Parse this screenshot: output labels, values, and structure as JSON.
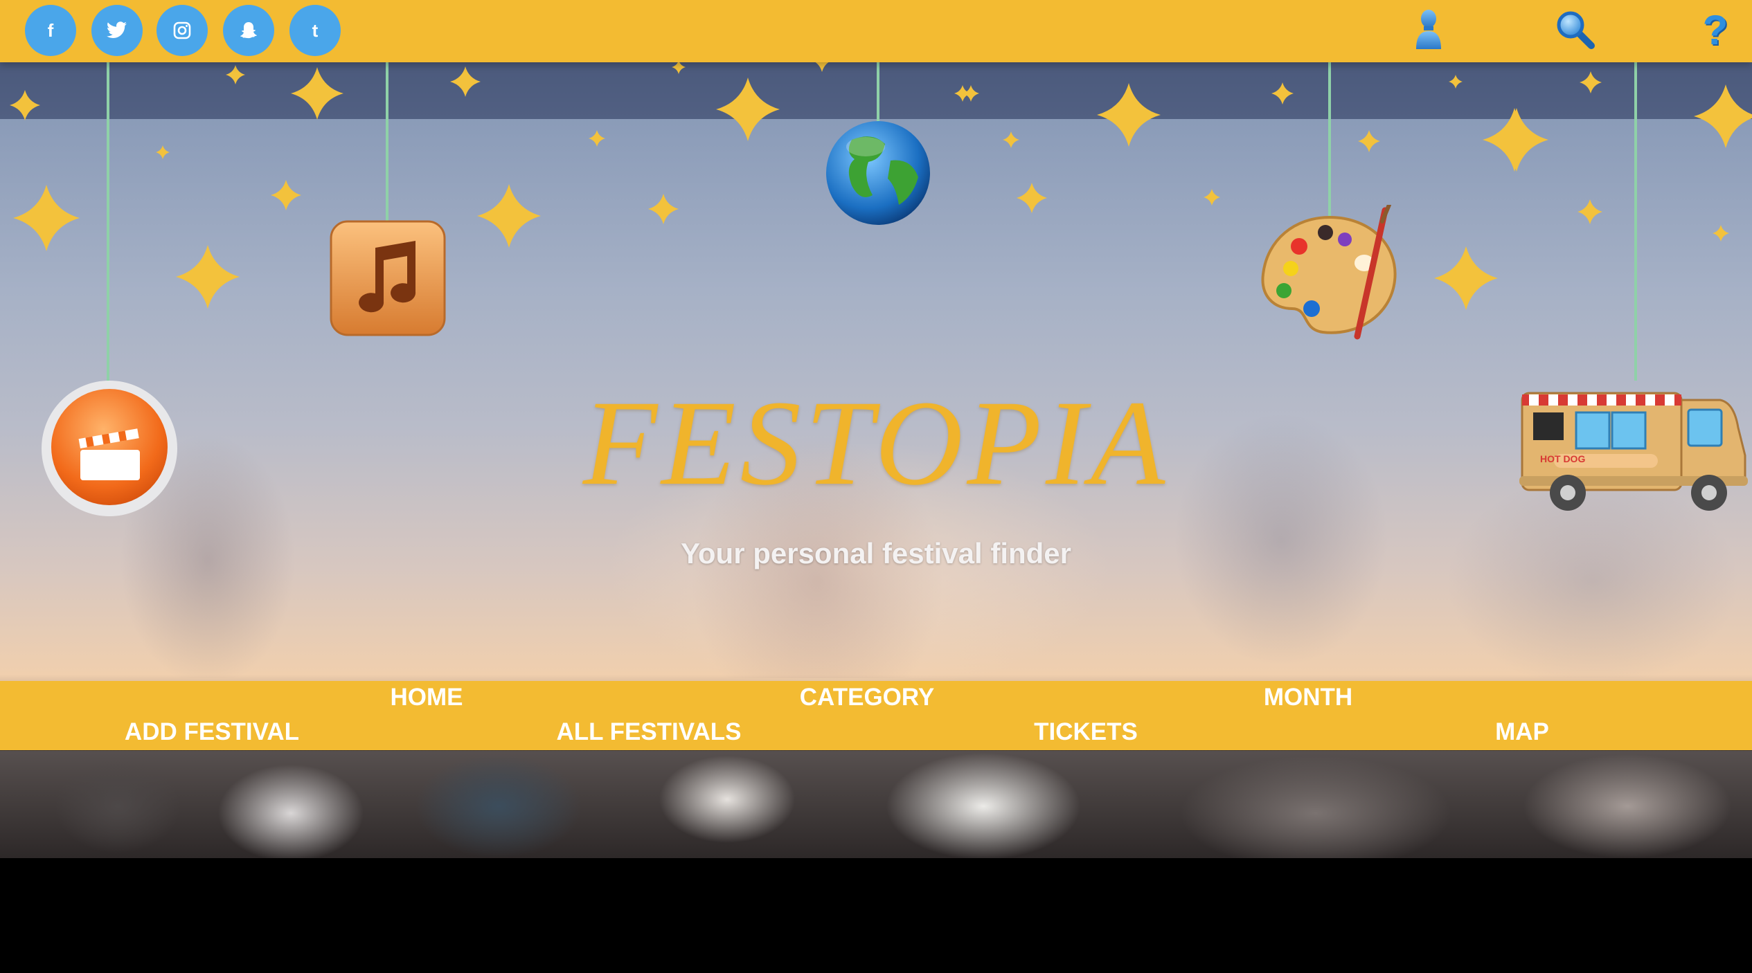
{
  "social": [
    {
      "name": "facebook",
      "glyph": "f"
    },
    {
      "name": "twitter",
      "glyph": "❧"
    },
    {
      "name": "instagram",
      "glyph": "▣"
    },
    {
      "name": "snapchat",
      "glyph": "⌂"
    },
    {
      "name": "tumblr",
      "glyph": "t"
    }
  ],
  "header_icons": [
    "user-icon",
    "search-icon",
    "help-icon"
  ],
  "help_glyph": "?",
  "hanging_icons": [
    "film-clapper-icon",
    "music-note-icon",
    "globe-icon",
    "paint-palette-icon",
    "food-truck-icon"
  ],
  "food_truck_text": "HOT DOG",
  "hero": {
    "title": "FESTOPIA",
    "tagline": "Your personal festival finder"
  },
  "nav": {
    "home": "HOME",
    "category": "CATEGORY",
    "month": "MONTH",
    "add_festival": "ADD FESTIVAL",
    "all_festivals": "ALL FESTIVALS",
    "tickets": "TICKETS",
    "map": "MAP"
  },
  "colors": {
    "bar": "#f3bb32",
    "social": "#4aa6ea",
    "title": "#f0b42c",
    "star": "#f3c23c"
  }
}
